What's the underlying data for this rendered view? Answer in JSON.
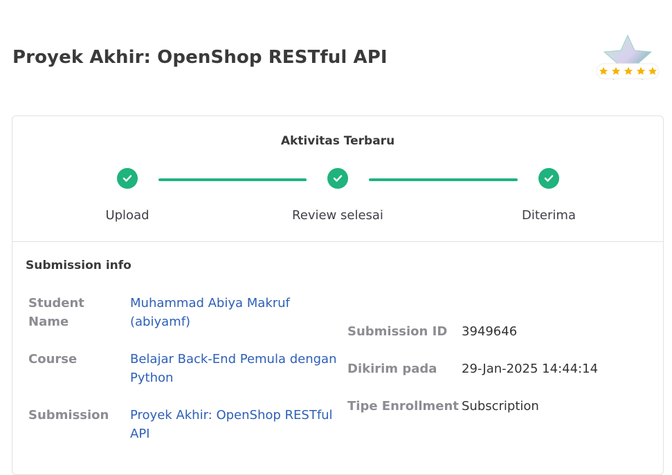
{
  "header": {
    "title": "Proyek Akhir: OpenShop RESTful API"
  },
  "colors": {
    "accent": "#1fb37e",
    "link": "#2d5fb8",
    "star": "#f6b400"
  },
  "activity": {
    "title": "Aktivitas Terbaru",
    "steps": [
      {
        "label": "Upload",
        "icon": "check-icon"
      },
      {
        "label": "Review selesai",
        "icon": "check-icon"
      },
      {
        "label": "Diterima",
        "icon": "check-icon"
      }
    ]
  },
  "submission_info": {
    "title": "Submission info",
    "left": [
      {
        "label_line1": "Student",
        "label_line2": "Name",
        "value_line1": "Muhammad Abiya Makruf",
        "value_line2": "(abiyamf)"
      },
      {
        "label": "Course",
        "value_line1": "Belajar Back-End Pemula dengan",
        "value_line2": "Python"
      },
      {
        "label": "Submission",
        "value_line1": "Proyek Akhir: OpenShop RESTful",
        "value_line2": "API"
      }
    ],
    "right": [
      {
        "label": "Submission ID",
        "value": "3949646"
      },
      {
        "label": "Dikirim pada",
        "value": "29-Jan-2025 14:44:14"
      },
      {
        "label": "Tipe Enrollment",
        "value": "Subscription"
      }
    ]
  },
  "badge": {
    "rating": 5,
    "icon": "star-badge-icon"
  }
}
